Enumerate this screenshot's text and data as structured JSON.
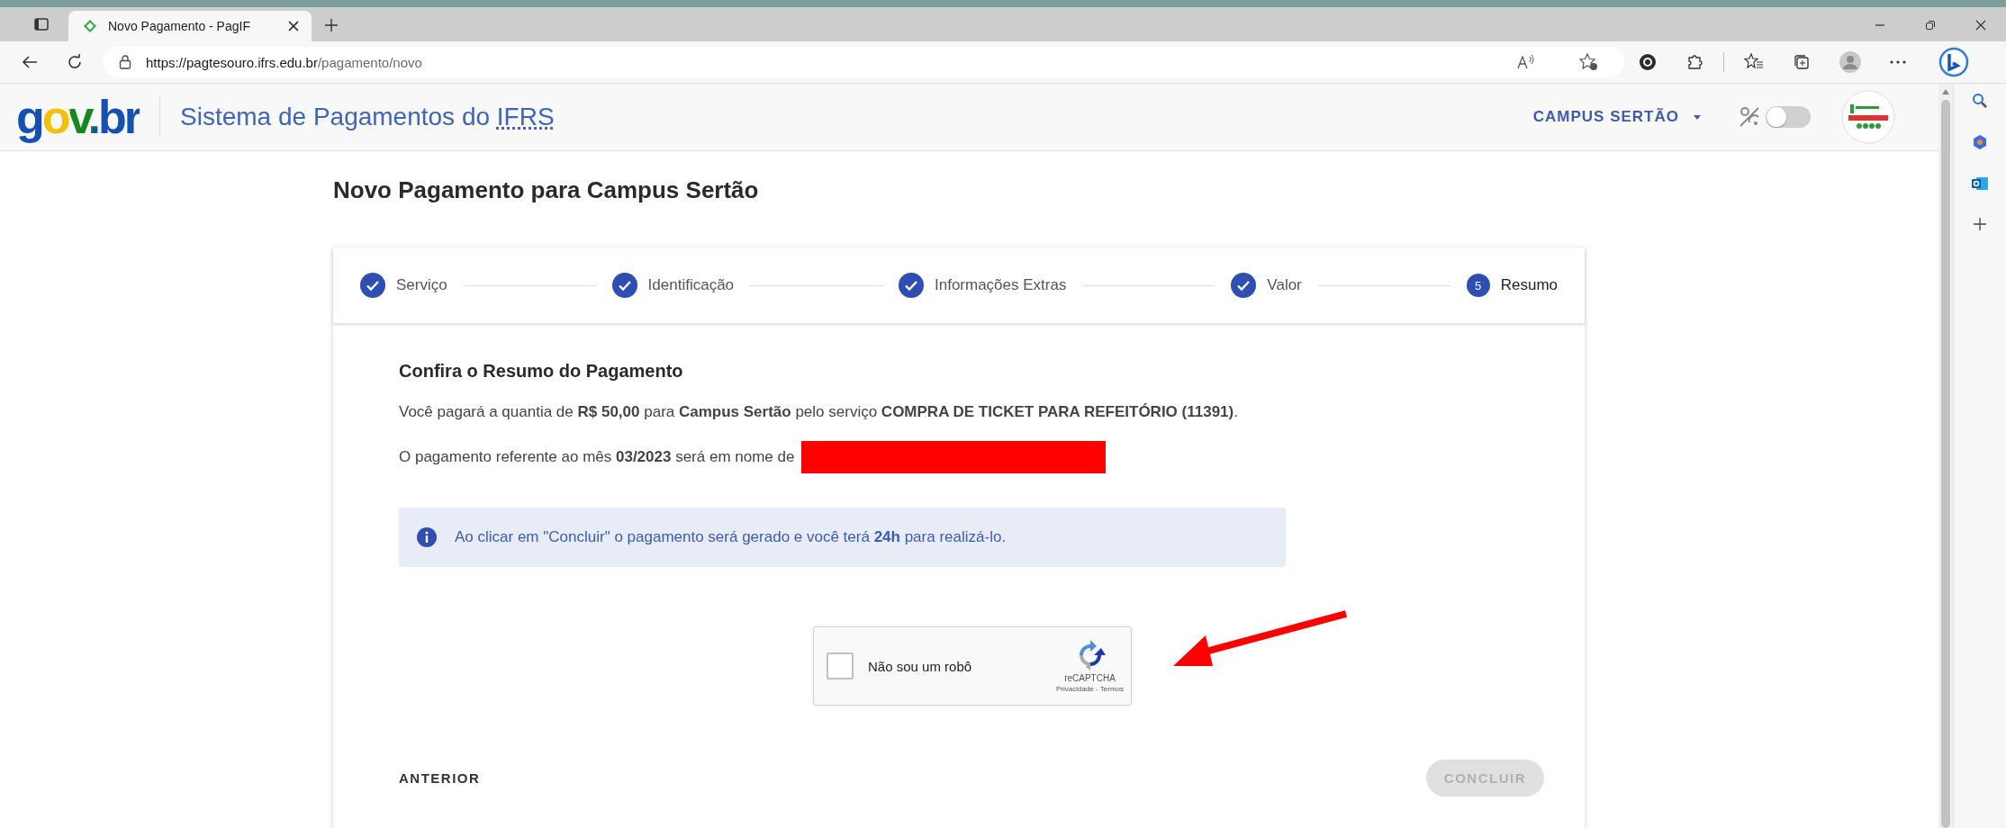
{
  "browser": {
    "tab_title": "Novo Pagamento - PagIF",
    "url_host": "https://pagtesouro.ifrs.edu.br",
    "url_path": "/pagamento/novo"
  },
  "header": {
    "logo": "gov.br",
    "title": "Sistema de Pagamentos do",
    "title_abbr": "IFRS",
    "campus": "CAMPUS SERTÃO",
    "dark_mode_on": false
  },
  "page_title": "Novo Pagamento para Campus Sertão",
  "steps": [
    {
      "label": "Serviço",
      "completed": true
    },
    {
      "label": "Identificação",
      "completed": true
    },
    {
      "label": "Informações Extras",
      "completed": true
    },
    {
      "label": "Valor",
      "completed": true
    },
    {
      "label": "Resumo",
      "completed": false,
      "number": "5"
    }
  ],
  "summary": {
    "heading": "Confira o Resumo do Pagamento",
    "paragraphs": [
      "Você pagará a quantia de **R$ 50,00** para **Campus Sertão** pelo serviço **COMPRA DE TICKET PARA REFEITÓRIO (11391)**.",
      "O pagamento referente ao mês **03/2023** será em nome de"
    ],
    "alert": "Ao clicar em \"Concluir\" o pagamento será gerado e você terá **24h** para realizá-lo."
  },
  "captcha": {
    "label": "Não sou um robô",
    "checked": false,
    "brand": "reCAPTCHA",
    "footer": "Privacidade - Termos"
  },
  "actions": {
    "back": "ANTERIOR",
    "next": "CONCLUIR",
    "next_disabled": true
  }
}
